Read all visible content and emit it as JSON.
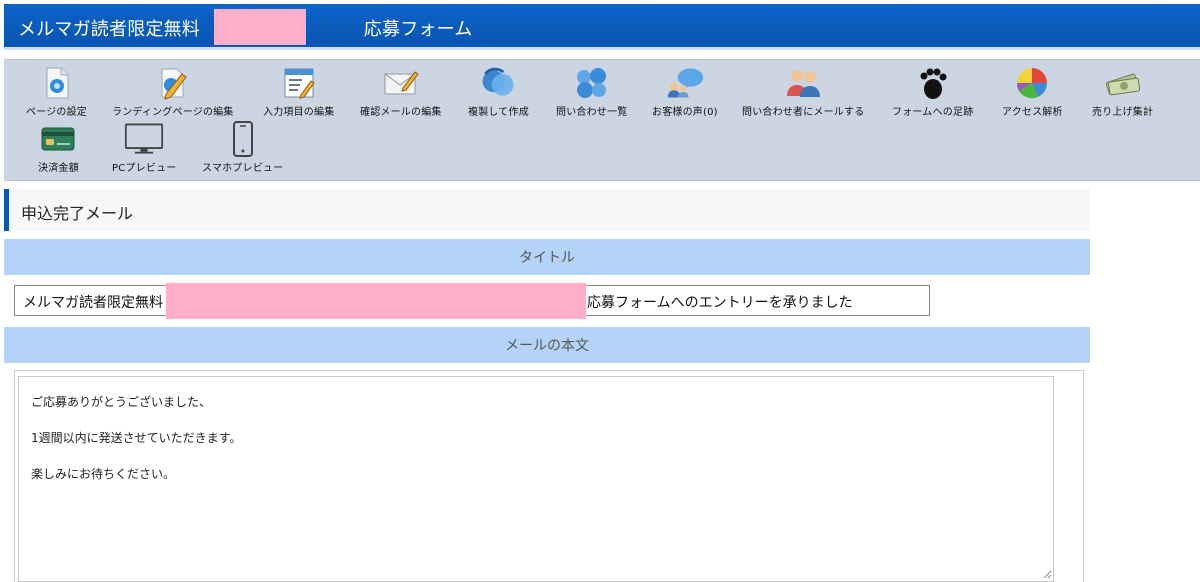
{
  "header": {
    "title": "メルマガ読者限定無料　　　　　　　　　応募フォーム",
    "brand_color": "#0a5ab9"
  },
  "toolbar": {
    "items": [
      {
        "label": "ページの設定",
        "icon": "page-settings-icon"
      },
      {
        "label": "ランディングページの編集",
        "icon": "landing-edit-icon"
      },
      {
        "label": "入力項目の編集",
        "icon": "form-fields-icon"
      },
      {
        "label": "確認メールの編集",
        "icon": "mail-edit-icon"
      },
      {
        "label": "複製して作成",
        "icon": "duplicate-icon"
      },
      {
        "label": "問い合わせ一覧",
        "icon": "inquiry-list-icon"
      },
      {
        "label": "お客様の声(0)",
        "icon": "customer-voice-icon"
      },
      {
        "label": "問い合わせ者にメールする",
        "icon": "mail-users-icon"
      },
      {
        "label": "フォームへの足跡",
        "icon": "footprint-icon"
      },
      {
        "label": "アクセス解析",
        "icon": "pie-chart-icon"
      },
      {
        "label": "売り上げ集計",
        "icon": "money-icon"
      },
      {
        "label": "決済金額",
        "icon": "credit-card-icon"
      },
      {
        "label": "PCプレビュー",
        "icon": "monitor-icon"
      },
      {
        "label": "スマホプレビュー",
        "icon": "smartphone-icon"
      }
    ]
  },
  "section": {
    "heading": "申込完了メール"
  },
  "title_band": {
    "label": "タイトル"
  },
  "title_field": {
    "value_head": "メルマガ読者限定無料",
    "value_tail": "応募フォームへのエントリーを承りました"
  },
  "body_band": {
    "label": "メールの本文"
  },
  "body": {
    "lines": [
      "ご応募ありがとうございました、",
      "1週間以内に発送させていただきます。",
      "楽しみにお待ちください。"
    ]
  }
}
